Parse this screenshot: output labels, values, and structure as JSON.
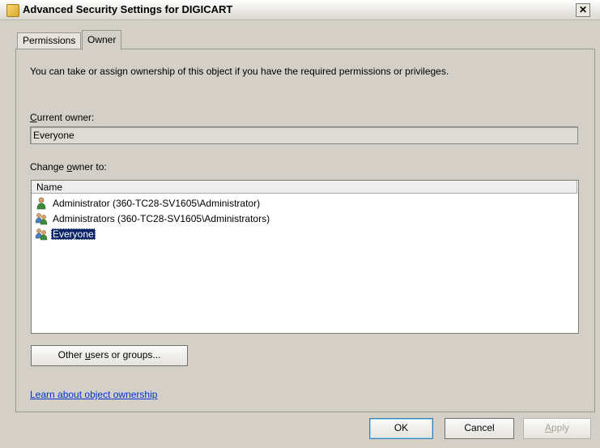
{
  "window": {
    "title": "Advanced Security Settings for DIGICART",
    "close_glyph": "✕"
  },
  "tabs": [
    {
      "label": "Permissions",
      "active": false
    },
    {
      "label": "Owner",
      "active": true
    }
  ],
  "owner_tab": {
    "description": "You can take or assign ownership of this object if you have the required permissions or privileges.",
    "current_owner_label_accel": "C",
    "current_owner_label_rest": "urrent owner:",
    "current_owner_value": "Everyone",
    "change_owner_label_pre": "Change ",
    "change_owner_label_accel": "o",
    "change_owner_label_rest": "wner to:",
    "list_header": "Name",
    "list_items": [
      {
        "label": "Administrator (360-TC28-SV1605\\Administrator)",
        "icon": "user-icon",
        "selected": false
      },
      {
        "label": "Administrators (360-TC28-SV1605\\Administrators)",
        "icon": "group-icon",
        "selected": false
      },
      {
        "label": "Everyone",
        "icon": "group-icon",
        "selected": true
      }
    ],
    "other_button_pre": "Other ",
    "other_button_accel": "u",
    "other_button_rest": "sers or groups...",
    "learn_link": "Learn about object ownership"
  },
  "footer": {
    "ok": "OK",
    "cancel": "Cancel",
    "apply_accel": "A",
    "apply_rest": "pply",
    "apply_enabled": false
  },
  "colors": {
    "selection": "#0a246a",
    "link": "#0033cc"
  }
}
